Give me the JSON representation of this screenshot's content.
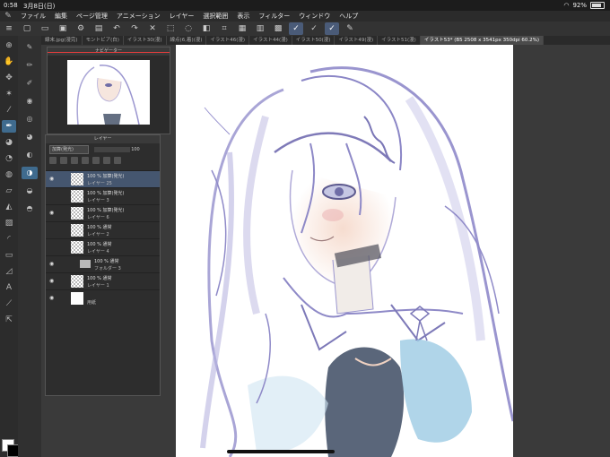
{
  "status": {
    "time": "0:58",
    "date": "3月8日(日)",
    "battery": "92%"
  },
  "menu": [
    "ファイル",
    "編集",
    "ページ管理",
    "アニメーション",
    "レイヤー",
    "選択範囲",
    "表示",
    "フィルター",
    "ウィンドウ",
    "ヘルプ"
  ],
  "tabs": [
    {
      "label": "線末.jpg(漫完)"
    },
    {
      "label": "モントビア(白)"
    },
    {
      "label": "イラスト30(漫)"
    },
    {
      "label": "線点(6,着)(漫)"
    },
    {
      "label": "イラスト46(漫)"
    },
    {
      "label": "イラスト44(漫)"
    },
    {
      "label": "イラスト50(漫)"
    },
    {
      "label": "イラスト49(漫)"
    },
    {
      "label": "イラスト51(漫)"
    },
    {
      "label": "イラスト53* (B5 2508 x 3541px 350dpi 60.2%)"
    }
  ],
  "panels": {
    "navigator_title": "ナビゲーター",
    "layers_title": "レイヤー"
  },
  "layer_controls": {
    "blend_mode": "加算(発光)",
    "opacity": "100"
  },
  "layers": [
    {
      "opacity_mode": "100 % 加算(発光)",
      "name": "レイヤー 25",
      "selected": true
    },
    {
      "opacity_mode": "100 % 加算(発光)",
      "name": "レイヤー 3"
    },
    {
      "opacity_mode": "100 % 加算(発光)",
      "name": "レイヤー 6"
    },
    {
      "opacity_mode": "100 % 通常",
      "name": "レイヤー 2"
    },
    {
      "opacity_mode": "100 % 通常",
      "name": "レイヤー 4"
    },
    {
      "opacity_mode": "100 % 通常",
      "name": "フォルダー 3"
    },
    {
      "opacity_mode": "100 % 通常",
      "name": "レイヤー 1"
    },
    {
      "opacity_mode": "",
      "name": "用紙"
    }
  ],
  "colors": {
    "accent": "#3f6b8e",
    "selected_layer": "#45566f",
    "sketch_line": "#8b86c6",
    "rule_red": "#e23c3c"
  }
}
